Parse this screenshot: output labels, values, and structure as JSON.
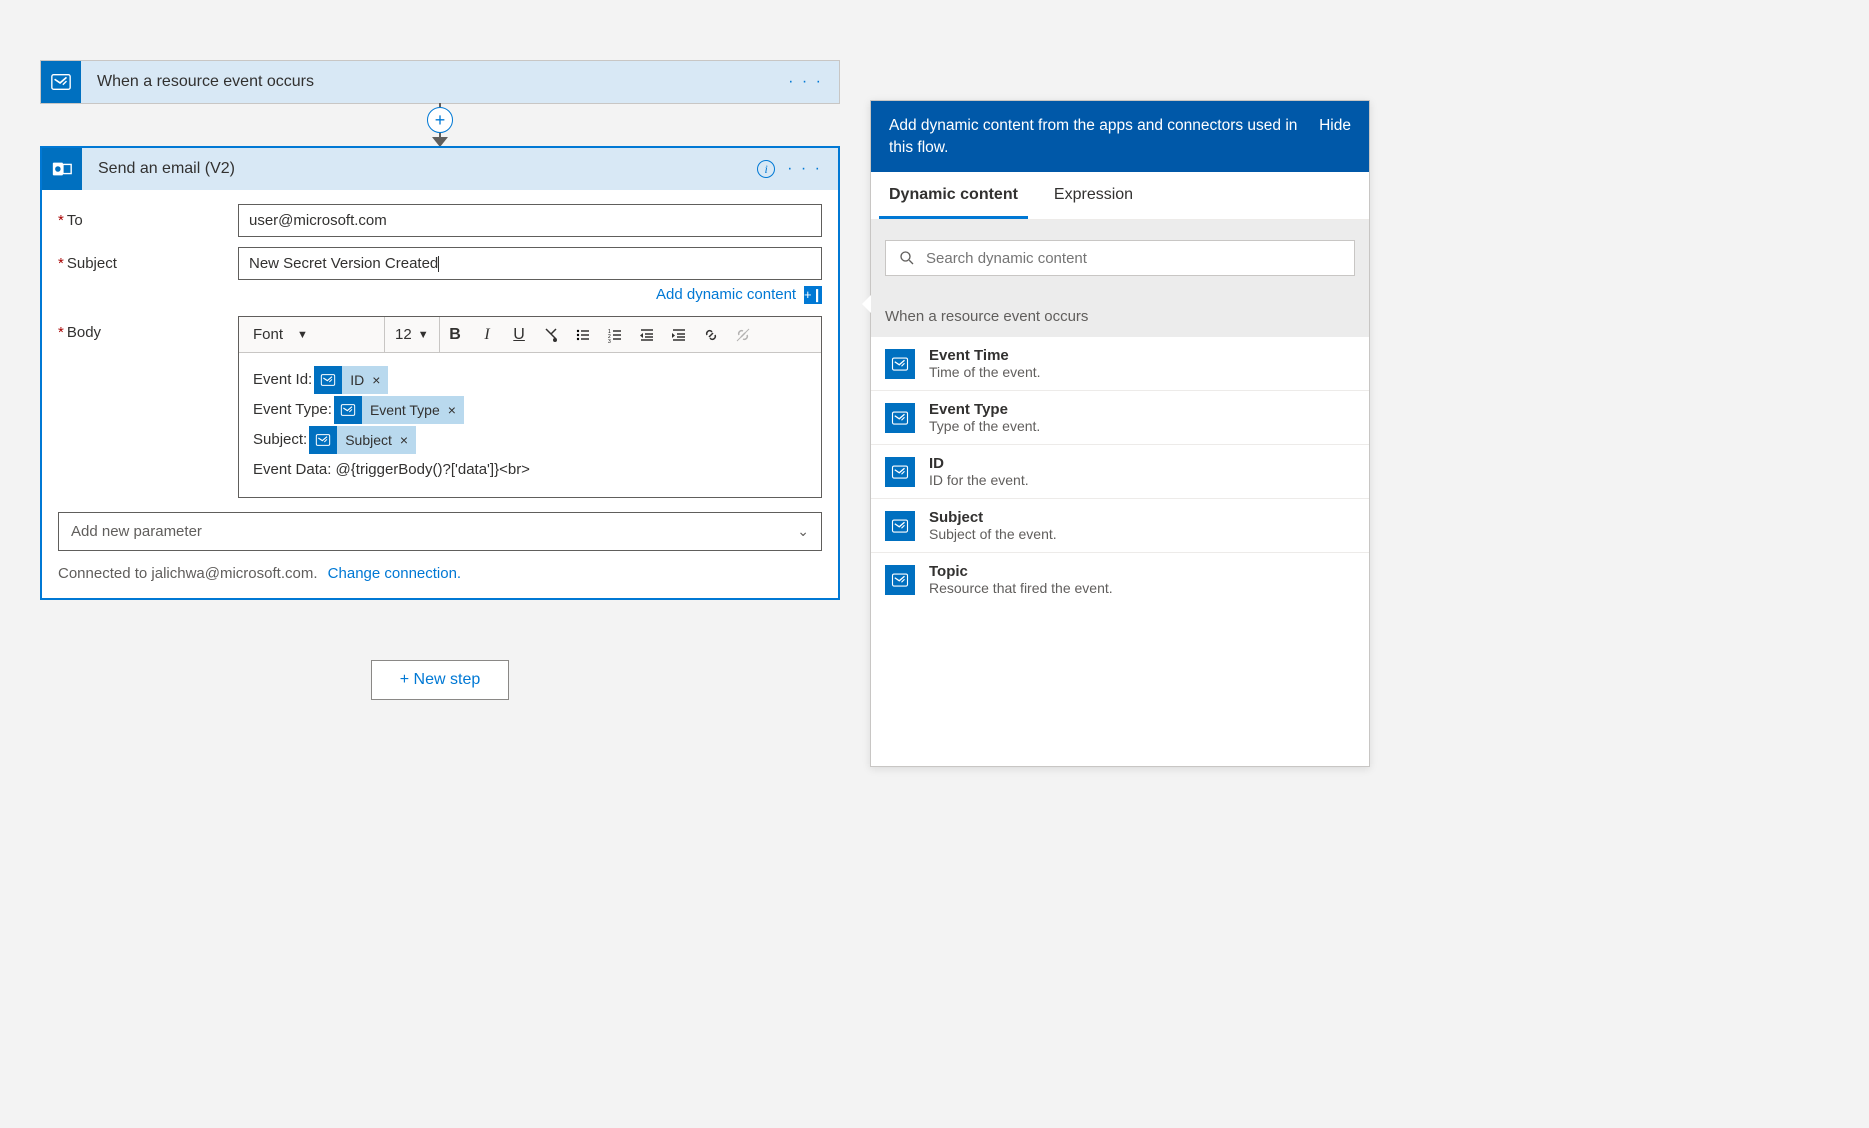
{
  "trigger": {
    "title": "When a resource event occurs"
  },
  "action": {
    "title": "Send an email (V2)",
    "fields": {
      "to_label": "To",
      "to_value": "user@microsoft.com",
      "subject_label": "Subject",
      "subject_value": "New Secret Version Created",
      "body_label": "Body"
    },
    "add_dynamic": "Add dynamic content",
    "toolbar": {
      "font": "Font",
      "size": "12"
    },
    "body_content": {
      "line1_label": "Event Id:",
      "token1": "ID",
      "line2_label": "Event Type:",
      "token2": "Event Type",
      "line3_label": "Subject:",
      "token3": "Subject",
      "line4": "Event Data: @{triggerBody()?['data']}<br>"
    },
    "param_placeholder": "Add new parameter",
    "connection_text": "Connected to jalichwa@microsoft.com.",
    "change_connection": "Change connection."
  },
  "new_step": "+ New step",
  "panel": {
    "header_text": "Add dynamic content from the apps and connectors used in this flow.",
    "hide": "Hide",
    "tab1": "Dynamic content",
    "tab2": "Expression",
    "search_placeholder": "Search dynamic content",
    "section": "When a resource event occurs",
    "items": [
      {
        "title": "Event Time",
        "desc": "Time of the event."
      },
      {
        "title": "Event Type",
        "desc": "Type of the event."
      },
      {
        "title": "ID",
        "desc": "ID for the event."
      },
      {
        "title": "Subject",
        "desc": "Subject of the event."
      },
      {
        "title": "Topic",
        "desc": "Resource that fired the event."
      }
    ]
  }
}
